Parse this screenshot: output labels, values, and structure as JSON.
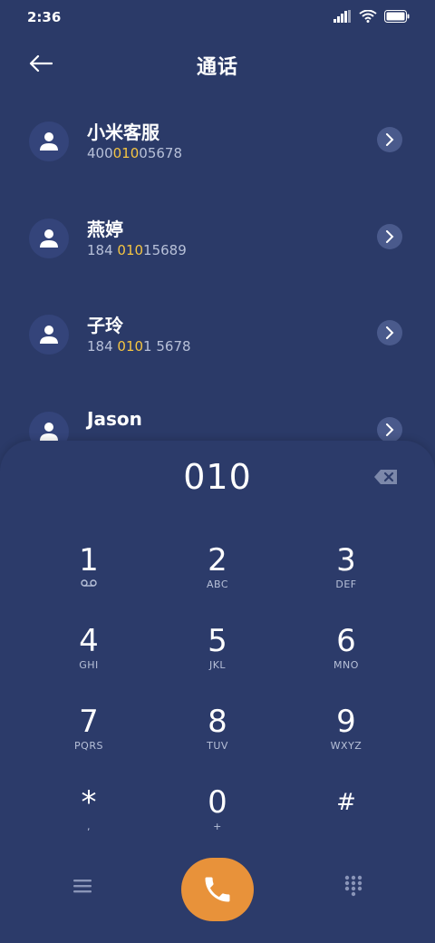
{
  "status": {
    "time": "2:36"
  },
  "header": {
    "title": "通话"
  },
  "contacts": [
    {
      "name": "小米客服",
      "num_pre": "400",
      "num_hl": "010",
      "num_post": "05678"
    },
    {
      "name": "燕婷",
      "num_pre": "184 ",
      "num_hl": "010",
      "num_post": "15689"
    },
    {
      "name": "子玲",
      "num_pre": "184 ",
      "num_hl": "010",
      "num_post": "1 5678"
    },
    {
      "name": "Jason",
      "num_pre": "",
      "num_hl": "",
      "num_post": ""
    }
  ],
  "dial": {
    "input": "010"
  },
  "keypad": {
    "k1": {
      "digit": "1",
      "letters": "⌒"
    },
    "k2": {
      "digit": "2",
      "letters": "ABC"
    },
    "k3": {
      "digit": "3",
      "letters": "DEF"
    },
    "k4": {
      "digit": "4",
      "letters": "GHI"
    },
    "k5": {
      "digit": "5",
      "letters": "JKL"
    },
    "k6": {
      "digit": "6",
      "letters": "MNO"
    },
    "k7": {
      "digit": "7",
      "letters": "PQRS"
    },
    "k8": {
      "digit": "8",
      "letters": "TUV"
    },
    "k9": {
      "digit": "9",
      "letters": "WXYZ"
    },
    "kstar": {
      "digit": "*",
      "letters": ","
    },
    "k0": {
      "digit": "0",
      "letters": "+"
    },
    "khash": {
      "digit": "#",
      "letters": ""
    }
  },
  "colors": {
    "background": "#2b3a68",
    "call_button": "#e8923a",
    "highlight": "#f5c542"
  }
}
